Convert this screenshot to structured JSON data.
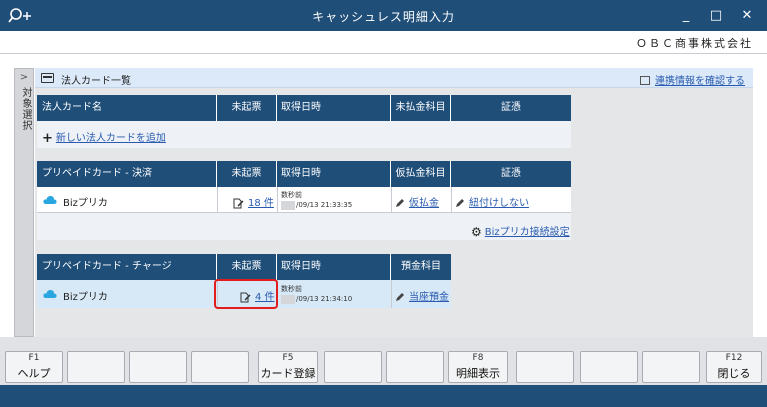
{
  "window": {
    "title": "キャッシュレス明細入力",
    "minimize": "_",
    "maximize": "□",
    "close": "✕"
  },
  "company": "ＯＢＣ商事株式会社",
  "sidebar": {
    "arrow": ">",
    "label": "対象選択"
  },
  "section": {
    "title": "法人カード一覧",
    "mapping_link": "連携情報を確認する"
  },
  "corp_table": {
    "headers": [
      "法人カード名",
      "未起票",
      "取得日時",
      "未払金科目",
      "証憑"
    ],
    "add_link": "新しい法人カードを追加"
  },
  "prepaid_settle": {
    "headers": [
      "プリペイドカード - 決済",
      "未起票",
      "取得日時",
      "仮払金科目",
      "証憑"
    ],
    "row": {
      "name": "Bizプリカ",
      "count": "18 件",
      "time_rel": "数秒前",
      "time": "/09/13 21:33:35",
      "account": "仮払金",
      "evidence": "紐付けしない"
    },
    "settings_link": "Bizプリカ接続設定"
  },
  "prepaid_charge": {
    "headers": [
      "プリペイドカード - チャージ",
      "未起票",
      "取得日時",
      "預金科目"
    ],
    "row": {
      "name": "Bizプリカ",
      "count": "4 件",
      "time_rel": "数秒前",
      "time": "/09/13 21:34:10",
      "account": "当座預金"
    }
  },
  "fkeys": [
    {
      "num": "F1",
      "label": "ヘルプ"
    },
    {
      "num": "",
      "label": ""
    },
    {
      "num": "",
      "label": ""
    },
    {
      "num": "",
      "label": ""
    },
    {
      "num": "F5",
      "label": "カード登録"
    },
    {
      "num": "",
      "label": ""
    },
    {
      "num": "",
      "label": ""
    },
    {
      "num": "F8",
      "label": "明細表示"
    },
    {
      "num": "",
      "label": ""
    },
    {
      "num": "",
      "label": ""
    },
    {
      "num": "",
      "label": ""
    },
    {
      "num": "F12",
      "label": "閉じる"
    }
  ],
  "colors": {
    "header": "#1f4e79",
    "highlight": "#e21d1d",
    "link": "#2a5bb0",
    "selected_row": "#d7e9f7"
  }
}
